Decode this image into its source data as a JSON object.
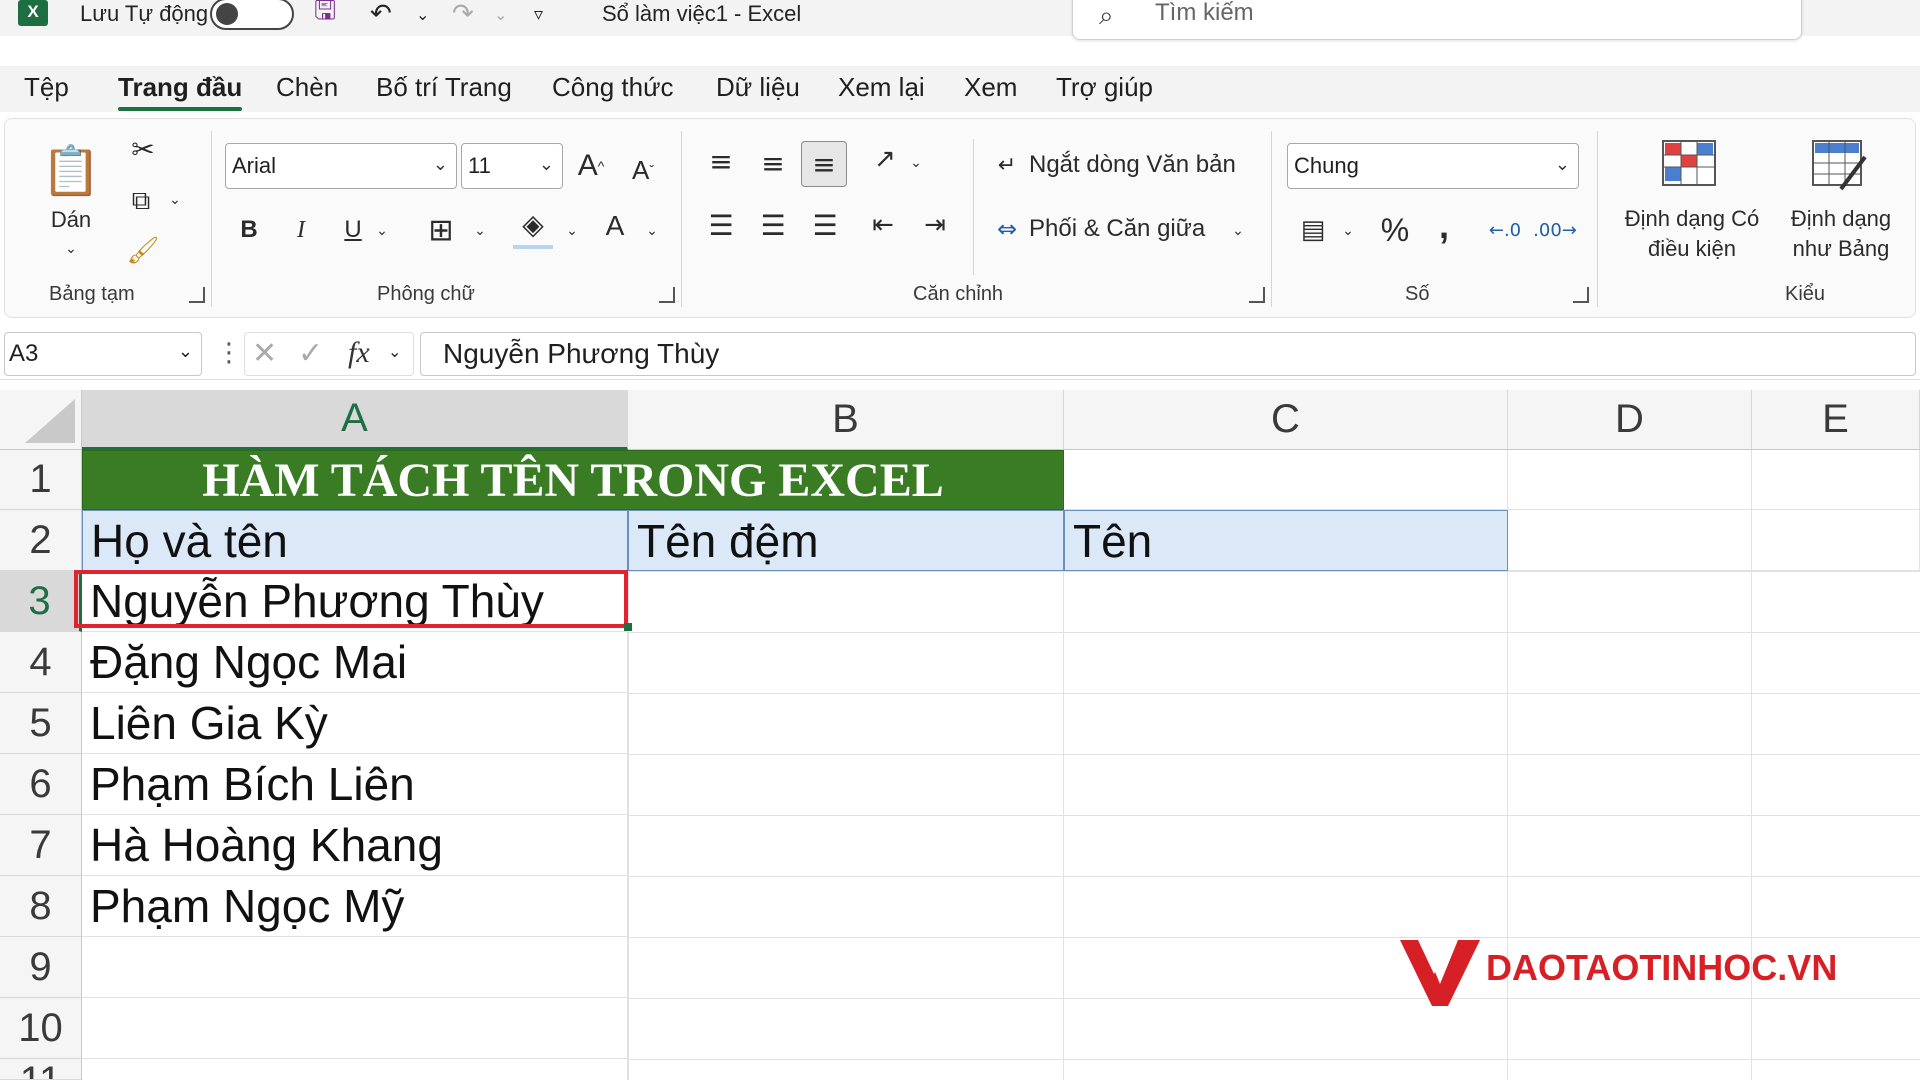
{
  "titlebar": {
    "autosave_label": "Lưu Tự động",
    "document_title": "Sổ làm việc1  -  Excel",
    "search_placeholder": "Tìm kiếm"
  },
  "tabs": [
    {
      "label": "Tệp"
    },
    {
      "label": "Trang đầu",
      "active": true
    },
    {
      "label": "Chèn"
    },
    {
      "label": "Bố trí Trang"
    },
    {
      "label": "Công thức"
    },
    {
      "label": "Dữ liệu"
    },
    {
      "label": "Xem lại"
    },
    {
      "label": "Xem"
    },
    {
      "label": "Trợ giúp"
    }
  ],
  "ribbon": {
    "clipboard": {
      "paste_label": "Dán",
      "group_label": "Bảng tạm"
    },
    "font": {
      "font_name": "Arial",
      "font_size": "11",
      "group_label": "Phông chữ"
    },
    "alignment": {
      "wrap_text_label": "Ngắt dòng Văn bản",
      "merge_center_label": "Phối & Căn giữa",
      "group_label": "Căn chỉnh"
    },
    "number": {
      "format_value": "Chung",
      "group_label": "Số"
    },
    "styles": {
      "conditional_line1": "Định dạng Có",
      "conditional_line2": "điều kiện",
      "format_table_line1": "Định dạng",
      "format_table_line2": "như Bảng",
      "group_label": "Kiểu"
    }
  },
  "formula_bar": {
    "name_box": "A3",
    "formula": "Nguyễn Phương Thùy"
  },
  "columns": [
    "A",
    "B",
    "C",
    "D",
    "E"
  ],
  "rows": [
    "1",
    "2",
    "3",
    "4",
    "5",
    "6",
    "7",
    "8",
    "9",
    "10",
    "11"
  ],
  "sheet": {
    "title": "HÀM TÁCH TÊN TRONG EXCEL",
    "headers": {
      "a": "Họ và tên",
      "b": "Tên đệm",
      "c": "Tên"
    },
    "names": [
      "Nguyễn Phương Thùy",
      "Đặng Ngọc Mai",
      "Liên Gia Kỳ",
      "Phạm Bích Liên",
      "Hà Hoàng Khang",
      "Phạm Ngọc Mỹ"
    ]
  },
  "colors": {
    "accent": "#1d6f42",
    "title_fill": "#3a7c24",
    "header_fill": "#dbe8f7",
    "selection_outline": "#e0232e",
    "watermark": "#d71f26"
  },
  "watermark": {
    "text": "DAOTAOTINHOC.VN"
  }
}
